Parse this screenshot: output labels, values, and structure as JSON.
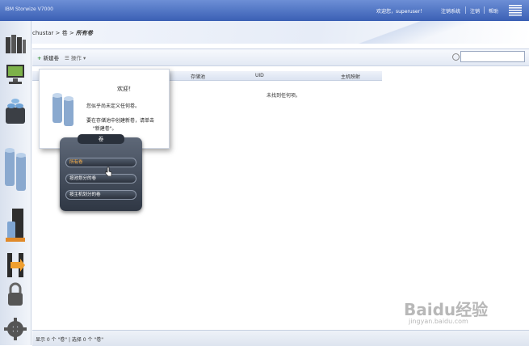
{
  "header": {
    "app_title": "IBM Storwize V7000",
    "welcome": "欢迎您，superuser！",
    "links": [
      "注销系统",
      "注销",
      "帮助"
    ],
    "logo": "IBM"
  },
  "breadcrumb": {
    "path": "chustar > 卷 > ",
    "current": "所有卷"
  },
  "toolbar": {
    "new_volume": "新建卷",
    "operations": "操作",
    "search_placeholder": ""
  },
  "table": {
    "columns": [
      "存储池",
      "UID",
      "主机映射"
    ],
    "empty_message": "未找到任何项。"
  },
  "welcome_popup": {
    "title": "欢迎！",
    "lines": [
      "您似乎尚未定义任何卷。",
      "要在存储池中创建新卷，请单击",
      "\"新建卷\"。"
    ]
  },
  "flyout_menu": {
    "title": "卷",
    "items": [
      "所有卷",
      "按池划分的卷",
      "按主机划分的卷"
    ],
    "active_index": 0
  },
  "status_bar": {
    "text": "显示 0 个 \"卷\" | 选择 0 个 \"卷\""
  },
  "watermark": {
    "brand": "Baidu经验",
    "url": "jingyan.baidu.com"
  },
  "colors": {
    "header_blue": "#3a5fb4",
    "menu_dark": "#2f3744",
    "active_orange": "#ffb347"
  }
}
